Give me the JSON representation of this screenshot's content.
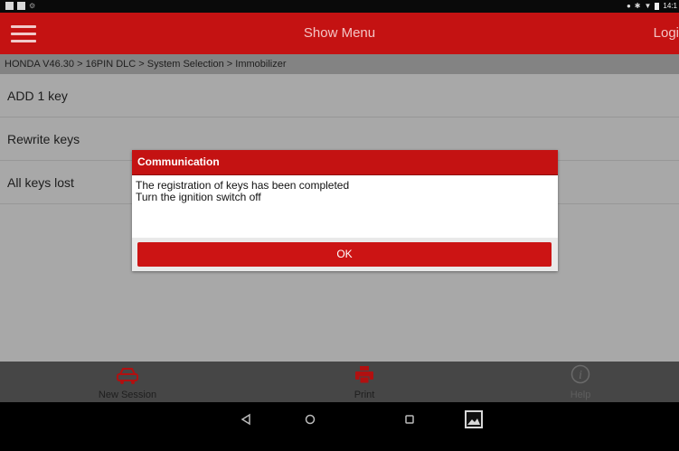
{
  "title_bar": {
    "title": "Show Menu",
    "login": "Logi"
  },
  "status_bar": {
    "time": "14:1"
  },
  "breadcrumb": "HONDA V46.30 > 16PIN DLC > System Selection > Immobilizer",
  "menu": {
    "items": [
      {
        "label": "ADD 1 key"
      },
      {
        "label": "Rewrite keys"
      },
      {
        "label": "All keys lost"
      }
    ]
  },
  "dialog": {
    "title": "Communication",
    "lines": [
      "The registration of keys has been completed",
      "Turn the ignition switch off"
    ],
    "ok_label": "OK"
  },
  "toolbar": {
    "new_session": "New Session",
    "print": "Print",
    "help": "Help"
  },
  "colors": {
    "brand_red": "#c41212",
    "overlay_gray": "#a8a8a8"
  },
  "icons": {
    "toolbar": [
      "car-icon",
      "printer-icon",
      "info-icon"
    ],
    "navbar": [
      "back-icon",
      "home-icon",
      "recents-icon",
      "screenshot-icon"
    ]
  }
}
